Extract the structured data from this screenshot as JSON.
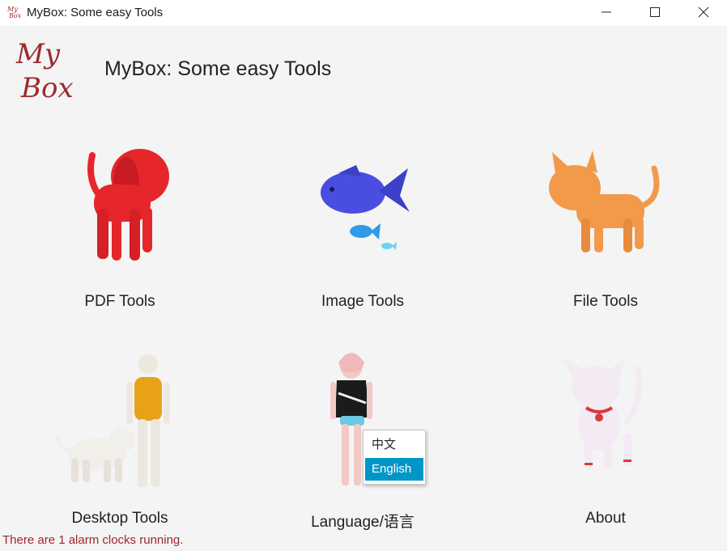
{
  "window": {
    "title": "MyBox: Some easy Tools",
    "controls": [
      "minimize-icon",
      "maximize-icon",
      "close-icon"
    ]
  },
  "header": {
    "logo_text_line1": "My",
    "logo_text_line2": "Box",
    "title": "MyBox: Some easy Tools"
  },
  "tools": [
    {
      "label": "PDF Tools",
      "icon": "red-dog-icon"
    },
    {
      "label": "Image Tools",
      "icon": "fish-icon"
    },
    {
      "label": "File Tools",
      "icon": "orange-cat-icon"
    },
    {
      "label": "Desktop Tools",
      "icon": "man-and-dog-icon"
    },
    {
      "label": "Language/语言",
      "icon": "girl-icon"
    },
    {
      "label": "About",
      "icon": "white-cat-icon"
    }
  ],
  "language_menu": {
    "items": [
      "中文",
      "English"
    ],
    "selected": "English"
  },
  "status": {
    "message": "There are 1 alarm clocks running."
  },
  "colors": {
    "selection": "#0096c9",
    "status_text": "#a0282a",
    "logo": "#9b2a2e"
  }
}
